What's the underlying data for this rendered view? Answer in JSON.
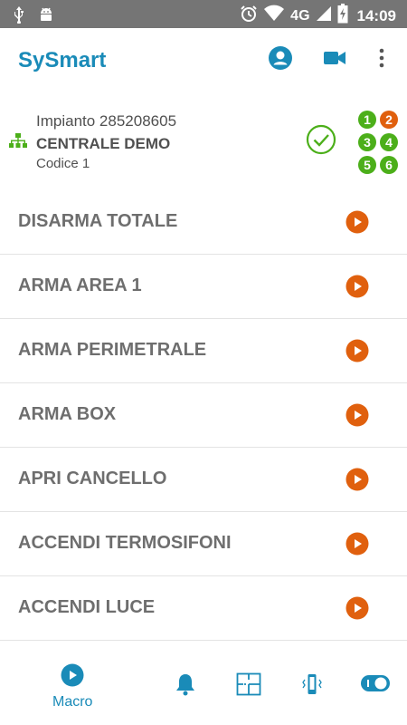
{
  "status_bar": {
    "network": "4G",
    "time": "14:09",
    "left_icons": [
      "usb-icon",
      "android-icon"
    ],
    "right_icons": [
      "alarm-clock-icon",
      "wifi-icon",
      "signal-icon",
      "battery-charging-icon"
    ]
  },
  "app_bar": {
    "title": "SySmart",
    "actions": [
      "account-icon",
      "video-camera-icon",
      "more-vert-icon"
    ]
  },
  "system": {
    "line1": "Impianto 285208605",
    "line2": "CENTRALE DEMO",
    "line3": "Codice 1",
    "areas": [
      {
        "n": "1",
        "color": "#4caf1a"
      },
      {
        "n": "2",
        "color": "#e0600e"
      },
      {
        "n": "3",
        "color": "#4caf1a"
      },
      {
        "n": "4",
        "color": "#4caf1a"
      },
      {
        "n": "5",
        "color": "#4caf1a"
      },
      {
        "n": "6",
        "color": "#4caf1a"
      }
    ]
  },
  "macros": [
    {
      "label": "DISARMA TOTALE"
    },
    {
      "label": "ARMA AREA 1"
    },
    {
      "label": "ARMA PERIMETRALE"
    },
    {
      "label": "ARMA BOX"
    },
    {
      "label": "APRI CANCELLO"
    },
    {
      "label": "ACCENDI TERMOSIFONI"
    },
    {
      "label": "ACCENDI LUCE"
    }
  ],
  "bottom_nav": {
    "macro_label": "Macro",
    "items": [
      "play-circle-icon",
      "bell-icon",
      "floor-plan-icon",
      "vibrate-device-icon",
      "toggle-switch-icon"
    ]
  },
  "colors": {
    "accent": "#1a8bb8",
    "play": "#e0600e",
    "ok": "#4caf1a",
    "status_bar": "#757575"
  }
}
